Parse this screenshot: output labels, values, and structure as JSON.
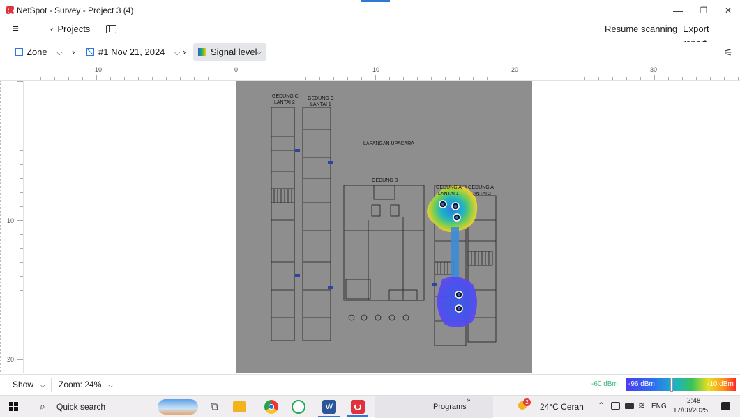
{
  "window": {
    "title": "NetSpot - Survey - Project 3 (4)",
    "minimize": "—",
    "maximize": "❐",
    "close": "✕"
  },
  "toolbar": {
    "menu_icon": "hamburger-icon",
    "back_label": "Projects",
    "resume_label": "Resume scanning",
    "export_label": "Export report..."
  },
  "breadcrumb": {
    "zone_label": "Zone",
    "snapshot_label": "#1 Nov 21, 2024",
    "visualization_label": "Signal level"
  },
  "ruler": {
    "top_labels": [
      "-10",
      "0",
      "10",
      "20",
      "30"
    ],
    "left_labels": [
      "10",
      "20"
    ]
  },
  "floorplan": {
    "labels": {
      "gedung_c_l2": "GEDUNG C",
      "gedung_c_l2b": "LANTAI 2",
      "gedung_c_l1": "GEDUNG C",
      "gedung_c_l1b": "LANTAI 1",
      "lapangan": "LAPANGAN UPACARA",
      "gedung_b": "GEDUNG B",
      "gedung_a_l1": "GEDUNG A",
      "gedung_a_l1b": "LANTAI 1",
      "gedung_a_l2": "GEDUNG A",
      "gedung_a_l2b": "ANTAI 2"
    }
  },
  "bottom": {
    "show_label": "Show",
    "zoom_label": "Zoom: 24%",
    "scale_min": "-60 dBm",
    "scale_mid": "-96 dBm",
    "scale_max": "-10 dBm"
  },
  "taskbar": {
    "search_label": "Quick search",
    "programs_label": "Programs",
    "weather": "24°C  Cerah",
    "lang": "ENG",
    "time": "2:48",
    "date": "17/08/2025",
    "notification_badge": "2"
  },
  "colors": {
    "accent": "#2d7ad6",
    "floor_bg": "#8e8e8e",
    "scale_low": "#4a3cf0",
    "scale_high": "#ff2a2a"
  }
}
